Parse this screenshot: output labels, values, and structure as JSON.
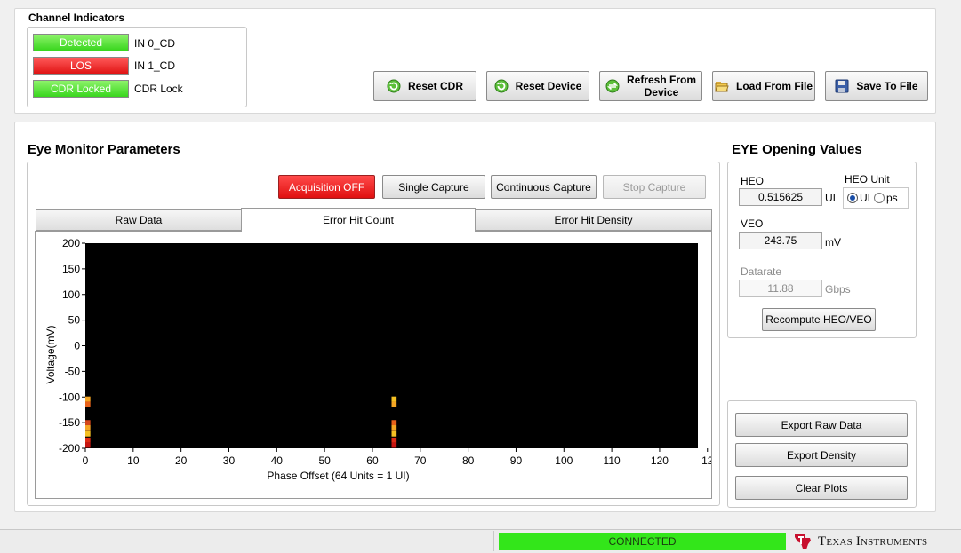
{
  "channel_indicators": {
    "title": "Channel Indicators",
    "items": [
      {
        "state": "Detected",
        "label": "IN 0_CD",
        "color": "#3fd623"
      },
      {
        "state": "LOS",
        "label": "IN 1_CD",
        "color": "#e81818"
      },
      {
        "state": "CDR Locked",
        "label": "CDR Lock",
        "color": "#3fd623"
      }
    ]
  },
  "toolbar": {
    "reset_cdr": "Reset CDR",
    "reset_device": "Reset Device",
    "refresh_line1": "Refresh From",
    "refresh_line2": "Device",
    "load_from_file": "Load From File",
    "save_to_file": "Save To File"
  },
  "eye_monitor": {
    "title": "Eye Monitor Parameters",
    "acquisition": "Acquisition OFF",
    "single_capture": "Single Capture",
    "continuous_capture": "Continuous Capture",
    "stop_capture": "Stop Capture",
    "tabs": [
      "Raw Data",
      "Error Hit Count",
      "Error Hit Density"
    ],
    "active_tab": "Error Hit Count"
  },
  "chart_data": {
    "type": "heatmap",
    "title": "",
    "xlabel": "Phase Offset (64 Units = 1 UI)",
    "ylabel": "Voltage(mV)",
    "xlim": [
      0,
      128
    ],
    "ylim": [
      -200,
      200
    ],
    "x_ticks": [
      "0",
      "10",
      "20",
      "30",
      "40",
      "50",
      "60",
      "70",
      "80",
      "90",
      "100",
      "110",
      "120",
      "12"
    ],
    "y_ticks": [
      "200",
      "150",
      "100",
      "50",
      "0",
      "-50",
      "-100",
      "-150",
      "-200"
    ],
    "background": "#000000",
    "cells": [
      {
        "x": 0,
        "y": -104,
        "color": "#f5a623"
      },
      {
        "x": 0,
        "y": -114,
        "color": "#e8621a"
      },
      {
        "x": 0,
        "y": -150,
        "color": "#d4461a"
      },
      {
        "x": 0,
        "y": -160,
        "color": "#f5a623"
      },
      {
        "x": 0,
        "y": -172,
        "color": "#f5c023"
      },
      {
        "x": 0,
        "y": -184,
        "color": "#e02a14"
      },
      {
        "x": 0,
        "y": -194,
        "color": "#c81410"
      },
      {
        "x": 64,
        "y": -104,
        "color": "#f5c023"
      },
      {
        "x": 64,
        "y": -114,
        "color": "#f5a623"
      },
      {
        "x": 64,
        "y": -150,
        "color": "#e8621a"
      },
      {
        "x": 64,
        "y": -160,
        "color": "#f5a623"
      },
      {
        "x": 64,
        "y": -172,
        "color": "#f5c023"
      },
      {
        "x": 64,
        "y": -184,
        "color": "#e02a14"
      },
      {
        "x": 64,
        "y": -194,
        "color": "#c81410"
      }
    ]
  },
  "eye_opening": {
    "title": "EYE Opening Values",
    "heo_label": "HEO",
    "heo_value": "0.515625",
    "heo_unit": "UI",
    "heo_unit_title": "HEO Unit",
    "unit_options": [
      "UI",
      "ps"
    ],
    "selected_unit": "UI",
    "veo_label": "VEO",
    "veo_value": "243.75",
    "veo_unit": "mV",
    "datarate_label": "Datarate",
    "datarate_value": "11.88",
    "datarate_unit": "Gbps",
    "recompute": "Recompute HEO/VEO"
  },
  "export": {
    "raw": "Export Raw Data",
    "density": "Export Density",
    "clear": "Clear Plots"
  },
  "status_bar": {
    "connection": "CONNECTED",
    "connection_color": "#33e61a",
    "brand": "Texas Instruments",
    "brand_color": "#c8102e"
  }
}
